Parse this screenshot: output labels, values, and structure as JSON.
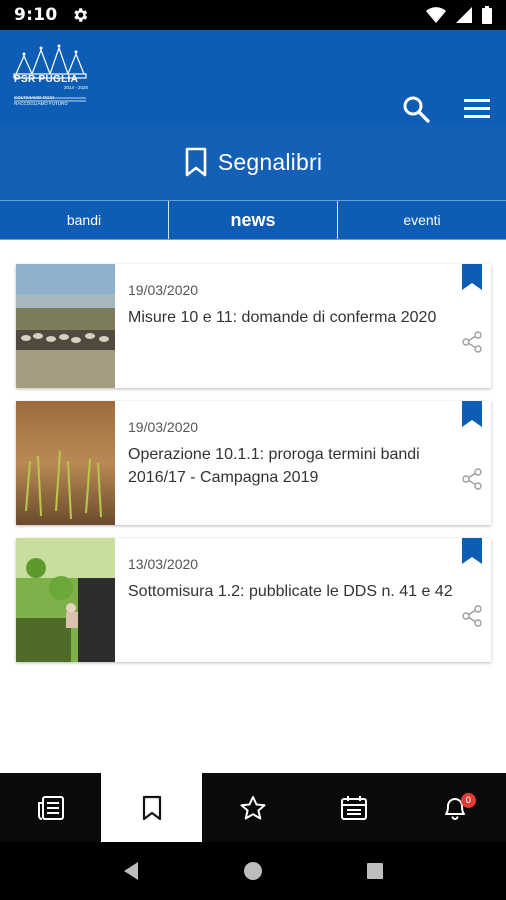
{
  "status_bar": {
    "time": "9:10"
  },
  "header": {
    "logo_title": "PSR PUGLIA",
    "logo_years": "2014 - 2020",
    "logo_tagline": "COLTIVIAMO OGGI",
    "logo_tagline2": "RACCOGLIAMO FUTURO"
  },
  "page": {
    "title": "Segnalibri"
  },
  "tabs": [
    {
      "label": "bandi"
    },
    {
      "label": "news"
    },
    {
      "label": "eventi"
    }
  ],
  "active_tab": "news",
  "news": [
    {
      "date": "19/03/2020",
      "title": "Misure 10 e 11: domande di conferma 2020"
    },
    {
      "date": "19/03/2020",
      "title": "Operazione 10.1.1: proroga termini bandi 2016/17 - Campagna 2019"
    },
    {
      "date": "13/03/2020",
      "title": "Sottomisura 1.2: pubblicate le DDS n. 41 e 42"
    }
  ],
  "bottom_nav": {
    "notification_count": "0",
    "items": [
      "news-list-icon",
      "bookmark-icon",
      "star-icon",
      "calendar-icon",
      "bell-icon"
    ],
    "active": "bookmark-icon"
  },
  "colors": {
    "brand_blue": "#0d5db5",
    "accent": "#1460b6",
    "badge": "#e53935"
  }
}
